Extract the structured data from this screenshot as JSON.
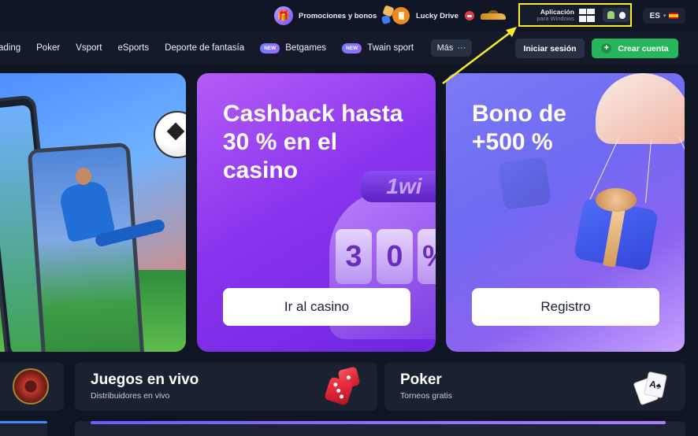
{
  "topbar": {
    "promotions_label": "Promociones y bonos",
    "lucky_drive_label": "Lucky Drive",
    "app": {
      "title": "Aplicación",
      "subtitle": "para Windows"
    },
    "language": "ES"
  },
  "nav": {
    "items": [
      {
        "label": "ading",
        "badge": ""
      },
      {
        "label": "Poker",
        "badge": ""
      },
      {
        "label": "Vsport",
        "badge": ""
      },
      {
        "label": "eSports",
        "badge": ""
      },
      {
        "label": "Deporte de fantasía",
        "badge": ""
      },
      {
        "label": "Betgames",
        "badge": "NEW"
      },
      {
        "label": "Twain sport",
        "badge": "NEW"
      }
    ],
    "more_label": "Más",
    "more_icon": "···"
  },
  "auth": {
    "login_label": "Iniciar sesión",
    "signup_label": "Crear cuenta"
  },
  "banners": {
    "casino": {
      "title": "Cashback hasta 30 % en el casino",
      "button": "Ir al casino",
      "slot_top": "1wi",
      "reels": [
        "3",
        "0",
        "%"
      ]
    },
    "bonus": {
      "title": "Bono de +500 %",
      "button": "Registro"
    }
  },
  "categories": {
    "live": {
      "title": "Juegos en vivo",
      "subtitle": "Distribuidores en vivo"
    },
    "poker": {
      "title": "Poker",
      "subtitle": "Torneos gratis",
      "card_glyph": "A♠"
    }
  },
  "colors": {
    "accent_green": "#28b65c",
    "highlight_yellow": "#fbec2b",
    "casino_purple": "#8a34ee",
    "bonus_indigo": "#6f6af2"
  }
}
